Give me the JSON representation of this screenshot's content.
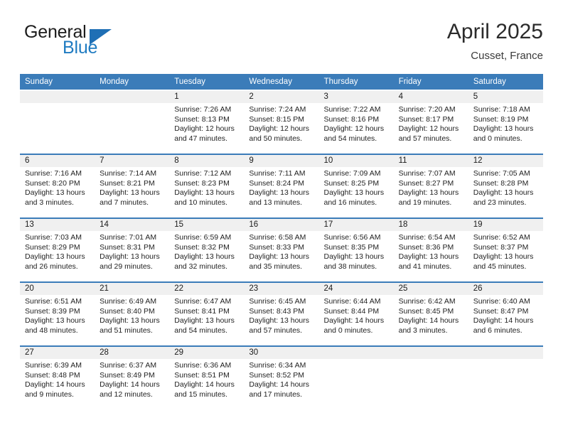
{
  "brand": {
    "name_part1": "General",
    "name_part2": "Blue",
    "triangle_icon": "triangle-logo-icon",
    "color_dark": "#1c1c1c",
    "color_blue": "#1f7bc1"
  },
  "header": {
    "title": "April 2025",
    "location": "Cusset, France"
  },
  "colors": {
    "header_blue": "#3b7cb9",
    "band_gray": "#f0f0f0",
    "text": "#1a1a1a"
  },
  "weekday_headers": [
    "Sunday",
    "Monday",
    "Tuesday",
    "Wednesday",
    "Thursday",
    "Friday",
    "Saturday"
  ],
  "weeks": [
    [
      {
        "day": "",
        "info": ""
      },
      {
        "day": "",
        "info": ""
      },
      {
        "day": "1",
        "info": "Sunrise: 7:26 AM\nSunset: 8:13 PM\nDaylight: 12 hours\nand 47 minutes."
      },
      {
        "day": "2",
        "info": "Sunrise: 7:24 AM\nSunset: 8:15 PM\nDaylight: 12 hours\nand 50 minutes."
      },
      {
        "day": "3",
        "info": "Sunrise: 7:22 AM\nSunset: 8:16 PM\nDaylight: 12 hours\nand 54 minutes."
      },
      {
        "day": "4",
        "info": "Sunrise: 7:20 AM\nSunset: 8:17 PM\nDaylight: 12 hours\nand 57 minutes."
      },
      {
        "day": "5",
        "info": "Sunrise: 7:18 AM\nSunset: 8:19 PM\nDaylight: 13 hours\nand 0 minutes."
      }
    ],
    [
      {
        "day": "6",
        "info": "Sunrise: 7:16 AM\nSunset: 8:20 PM\nDaylight: 13 hours\nand 3 minutes."
      },
      {
        "day": "7",
        "info": "Sunrise: 7:14 AM\nSunset: 8:21 PM\nDaylight: 13 hours\nand 7 minutes."
      },
      {
        "day": "8",
        "info": "Sunrise: 7:12 AM\nSunset: 8:23 PM\nDaylight: 13 hours\nand 10 minutes."
      },
      {
        "day": "9",
        "info": "Sunrise: 7:11 AM\nSunset: 8:24 PM\nDaylight: 13 hours\nand 13 minutes."
      },
      {
        "day": "10",
        "info": "Sunrise: 7:09 AM\nSunset: 8:25 PM\nDaylight: 13 hours\nand 16 minutes."
      },
      {
        "day": "11",
        "info": "Sunrise: 7:07 AM\nSunset: 8:27 PM\nDaylight: 13 hours\nand 19 minutes."
      },
      {
        "day": "12",
        "info": "Sunrise: 7:05 AM\nSunset: 8:28 PM\nDaylight: 13 hours\nand 23 minutes."
      }
    ],
    [
      {
        "day": "13",
        "info": "Sunrise: 7:03 AM\nSunset: 8:29 PM\nDaylight: 13 hours\nand 26 minutes."
      },
      {
        "day": "14",
        "info": "Sunrise: 7:01 AM\nSunset: 8:31 PM\nDaylight: 13 hours\nand 29 minutes."
      },
      {
        "day": "15",
        "info": "Sunrise: 6:59 AM\nSunset: 8:32 PM\nDaylight: 13 hours\nand 32 minutes."
      },
      {
        "day": "16",
        "info": "Sunrise: 6:58 AM\nSunset: 8:33 PM\nDaylight: 13 hours\nand 35 minutes."
      },
      {
        "day": "17",
        "info": "Sunrise: 6:56 AM\nSunset: 8:35 PM\nDaylight: 13 hours\nand 38 minutes."
      },
      {
        "day": "18",
        "info": "Sunrise: 6:54 AM\nSunset: 8:36 PM\nDaylight: 13 hours\nand 41 minutes."
      },
      {
        "day": "19",
        "info": "Sunrise: 6:52 AM\nSunset: 8:37 PM\nDaylight: 13 hours\nand 45 minutes."
      }
    ],
    [
      {
        "day": "20",
        "info": "Sunrise: 6:51 AM\nSunset: 8:39 PM\nDaylight: 13 hours\nand 48 minutes."
      },
      {
        "day": "21",
        "info": "Sunrise: 6:49 AM\nSunset: 8:40 PM\nDaylight: 13 hours\nand 51 minutes."
      },
      {
        "day": "22",
        "info": "Sunrise: 6:47 AM\nSunset: 8:41 PM\nDaylight: 13 hours\nand 54 minutes."
      },
      {
        "day": "23",
        "info": "Sunrise: 6:45 AM\nSunset: 8:43 PM\nDaylight: 13 hours\nand 57 minutes."
      },
      {
        "day": "24",
        "info": "Sunrise: 6:44 AM\nSunset: 8:44 PM\nDaylight: 14 hours\nand 0 minutes."
      },
      {
        "day": "25",
        "info": "Sunrise: 6:42 AM\nSunset: 8:45 PM\nDaylight: 14 hours\nand 3 minutes."
      },
      {
        "day": "26",
        "info": "Sunrise: 6:40 AM\nSunset: 8:47 PM\nDaylight: 14 hours\nand 6 minutes."
      }
    ],
    [
      {
        "day": "27",
        "info": "Sunrise: 6:39 AM\nSunset: 8:48 PM\nDaylight: 14 hours\nand 9 minutes."
      },
      {
        "day": "28",
        "info": "Sunrise: 6:37 AM\nSunset: 8:49 PM\nDaylight: 14 hours\nand 12 minutes."
      },
      {
        "day": "29",
        "info": "Sunrise: 6:36 AM\nSunset: 8:51 PM\nDaylight: 14 hours\nand 15 minutes."
      },
      {
        "day": "30",
        "info": "Sunrise: 6:34 AM\nSunset: 8:52 PM\nDaylight: 14 hours\nand 17 minutes."
      },
      {
        "day": "",
        "info": ""
      },
      {
        "day": "",
        "info": ""
      },
      {
        "day": "",
        "info": ""
      }
    ]
  ]
}
